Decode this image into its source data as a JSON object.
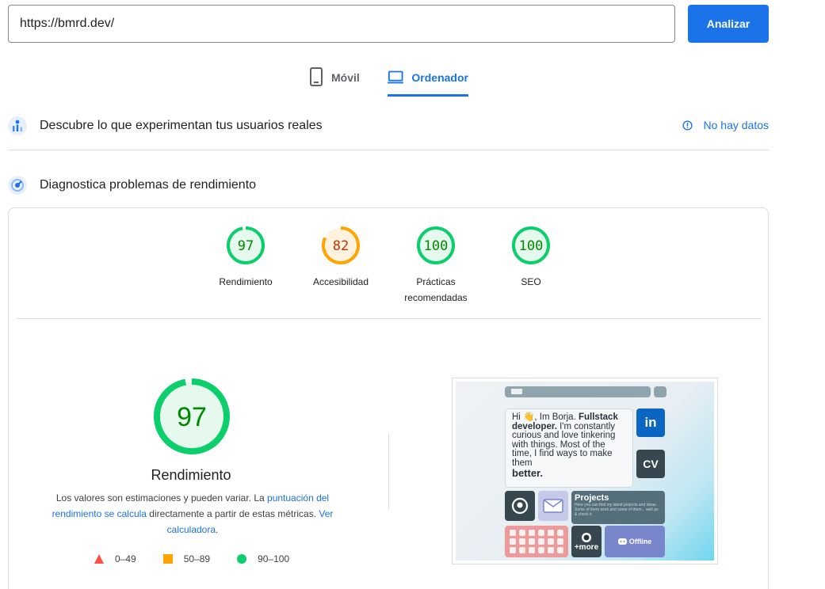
{
  "url_bar": {
    "value": "https://bmrd.dev/",
    "analyze_label": "Analizar"
  },
  "tabs": [
    {
      "label": "Móvil",
      "active": false
    },
    {
      "label": "Ordenador",
      "active": true
    }
  ],
  "field_data": {
    "title": "Descubre lo que experimentan tus usuarios reales",
    "status": "No hay datos"
  },
  "lab": {
    "title": "Diagnostica problemas de rendimiento"
  },
  "scores": [
    {
      "label": "Rendimiento",
      "value": "97",
      "fraction": 0.97,
      "color": "#0cce6b",
      "text_color": "#008800"
    },
    {
      "label": "Accesibilidad",
      "value": "82",
      "fraction": 0.82,
      "color": "#ffa400",
      "text_color": "#c33300"
    },
    {
      "label": "Prácticas recomendadas",
      "value": "100",
      "fraction": 1.0,
      "color": "#0cce6b",
      "text_color": "#008800"
    },
    {
      "label": "SEO",
      "value": "100",
      "fraction": 1.0,
      "color": "#0cce6b",
      "text_color": "#008800"
    }
  ],
  "main_score": {
    "value": "97",
    "fraction": 0.97,
    "label": "Rendimiento"
  },
  "explanation": {
    "part1": "Los valores son estimaciones y pueden variar. La ",
    "link1": "puntuación del rendimiento se calcula",
    "part2": " directamente a partir de estas métricas. ",
    "link2": "Ver calculadora",
    "part3": "."
  },
  "legend": [
    {
      "range": "0–49",
      "color": "#ff4e42",
      "shape": "triangle"
    },
    {
      "range": "50–89",
      "color": "#ffa400",
      "shape": "square"
    },
    {
      "range": "90–100",
      "color": "#0cce6b",
      "shape": "circle"
    }
  ],
  "preview": {
    "bio_intro": "Hi 👋, Im Borja. ",
    "bio_bold": "Fullstack developer.",
    "bio_rest": " I'm constantly curious and love tinkering with things. Most of the time, I find ways to make them",
    "bio_end": "better.",
    "linkedin": "in",
    "cv": "CV",
    "projects_title": "Projects",
    "projects_text": "Here you can find my latest projects and ideas. Some of them work and some of them... well go & check it",
    "more": "+more",
    "discord": "Offline"
  }
}
